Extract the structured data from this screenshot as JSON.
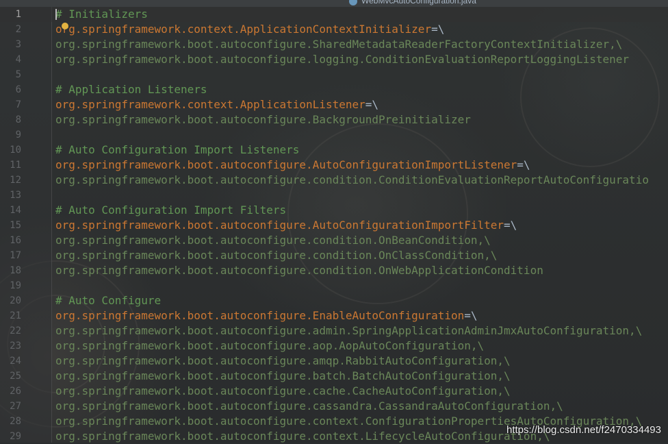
{
  "window": {
    "tab_title": "WebMvcAutoConfiguration.java",
    "tab_icon": "class-file-icon"
  },
  "editor": {
    "lines": [
      {
        "num": "1",
        "kind": "comment",
        "text": "# Initializers"
      },
      {
        "num": "2",
        "kind": "key",
        "text": "org.springframework.context.ApplicationContextInitializer",
        "eq": "=\\"
      },
      {
        "num": "3",
        "kind": "value",
        "text": "org.springframework.boot.autoconfigure.SharedMetadataReaderFactoryContextInitializer,\\"
      },
      {
        "num": "4",
        "kind": "value",
        "text": "org.springframework.boot.autoconfigure.logging.ConditionEvaluationReportLoggingListener"
      },
      {
        "num": "5",
        "kind": "empty",
        "text": ""
      },
      {
        "num": "6",
        "kind": "comment",
        "text": "# Application Listeners"
      },
      {
        "num": "7",
        "kind": "key",
        "text": "org.springframework.context.ApplicationListener",
        "eq": "=\\"
      },
      {
        "num": "8",
        "kind": "value",
        "text": "org.springframework.boot.autoconfigure.BackgroundPreinitializer"
      },
      {
        "num": "9",
        "kind": "empty",
        "text": ""
      },
      {
        "num": "10",
        "kind": "comment",
        "text": "# Auto Configuration Import Listeners"
      },
      {
        "num": "11",
        "kind": "key",
        "text": "org.springframework.boot.autoconfigure.AutoConfigurationImportListener",
        "eq": "=\\"
      },
      {
        "num": "12",
        "kind": "value",
        "text": "org.springframework.boot.autoconfigure.condition.ConditionEvaluationReportAutoConfiguratio"
      },
      {
        "num": "13",
        "kind": "empty",
        "text": ""
      },
      {
        "num": "14",
        "kind": "comment",
        "text": "# Auto Configuration Import Filters"
      },
      {
        "num": "15",
        "kind": "key",
        "text": "org.springframework.boot.autoconfigure.AutoConfigurationImportFilter",
        "eq": "=\\"
      },
      {
        "num": "16",
        "kind": "value",
        "text": "org.springframework.boot.autoconfigure.condition.OnBeanCondition,\\"
      },
      {
        "num": "17",
        "kind": "value",
        "text": "org.springframework.boot.autoconfigure.condition.OnClassCondition,\\"
      },
      {
        "num": "18",
        "kind": "value",
        "text": "org.springframework.boot.autoconfigure.condition.OnWebApplicationCondition"
      },
      {
        "num": "19",
        "kind": "empty",
        "text": ""
      },
      {
        "num": "20",
        "kind": "comment",
        "text": "# Auto Configure"
      },
      {
        "num": "21",
        "kind": "key",
        "text": "org.springframework.boot.autoconfigure.EnableAutoConfiguration",
        "eq": "=\\"
      },
      {
        "num": "22",
        "kind": "value",
        "text": "org.springframework.boot.autoconfigure.admin.SpringApplicationAdminJmxAutoConfiguration,\\"
      },
      {
        "num": "23",
        "kind": "value",
        "text": "org.springframework.boot.autoconfigure.aop.AopAutoConfiguration,\\"
      },
      {
        "num": "24",
        "kind": "value",
        "text": "org.springframework.boot.autoconfigure.amqp.RabbitAutoConfiguration,\\"
      },
      {
        "num": "25",
        "kind": "value",
        "text": "org.springframework.boot.autoconfigure.batch.BatchAutoConfiguration,\\"
      },
      {
        "num": "26",
        "kind": "value",
        "text": "org.springframework.boot.autoconfigure.cache.CacheAutoConfiguration,\\"
      },
      {
        "num": "27",
        "kind": "value",
        "text": "org.springframework.boot.autoconfigure.cassandra.CassandraAutoConfiguration,\\"
      },
      {
        "num": "28",
        "kind": "value",
        "text": "org.springframework.boot.autoconfigure.context.ConfigurationPropertiesAutoConfiguration,\\"
      },
      {
        "num": "29",
        "kind": "value",
        "text": "org.springframework.boot.autoconfigure.context.LifecycleAutoConfiguration,\\"
      }
    ],
    "current_line": "1",
    "intention_bulb_icon": "lightbulb-icon"
  },
  "watermark": "https://blog.csdn.net/f2470334493",
  "colors": {
    "comment": "#629755",
    "key": "#cc7832",
    "value": "#6a8759",
    "line_number": "#606366"
  }
}
